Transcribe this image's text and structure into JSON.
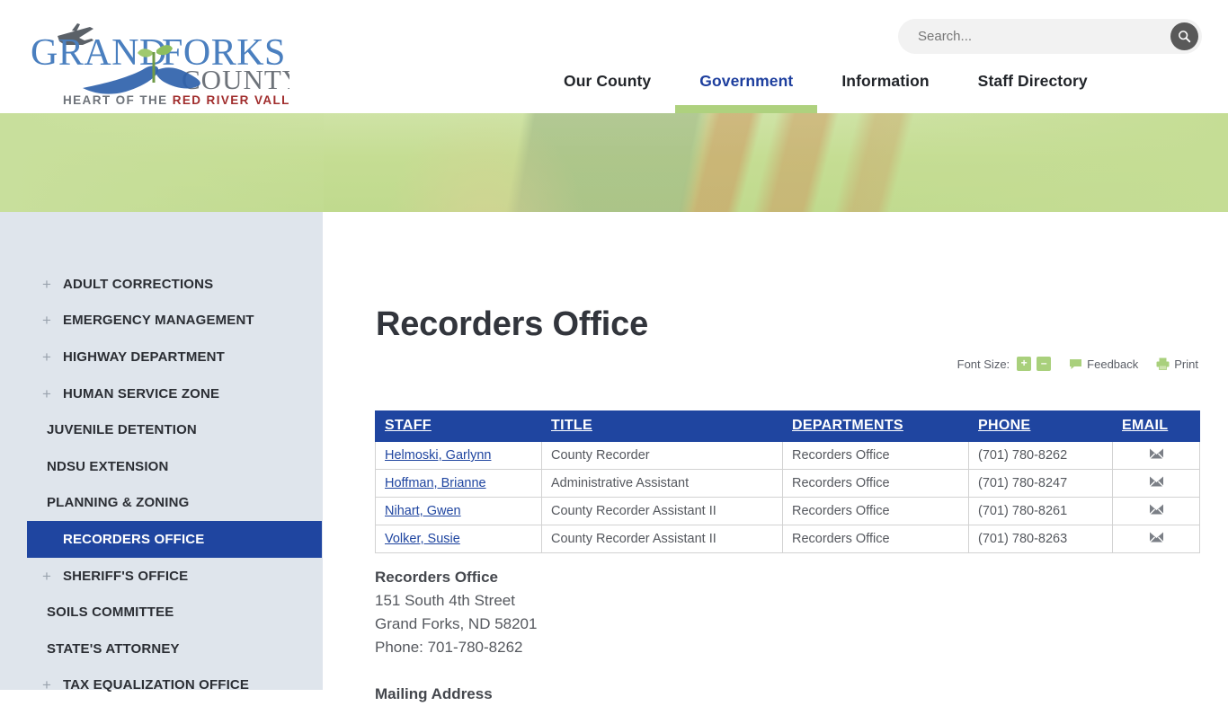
{
  "site": {
    "logo": {
      "line1": "GRAND",
      "line2": "FORKS",
      "line3": "COUNTY",
      "tagline_plain_1": "HEART OF THE ",
      "tagline_accent": "RED RIVER VALLEY"
    },
    "colors": {
      "brand_blue": "#1f45a0",
      "logo_blue": "#4a7fbf",
      "accent_green": "#a9d07c",
      "banner_green": "#c3dd96",
      "sidebar_bg": "#dfe5ec",
      "logo_red": "#a02c2c"
    }
  },
  "search": {
    "placeholder": "Search...",
    "value": "",
    "icon": "search-icon"
  },
  "nav": {
    "items": [
      {
        "label": "Our County",
        "active": false
      },
      {
        "label": "Government",
        "active": true
      },
      {
        "label": "Information",
        "active": false
      },
      {
        "label": "Staff Directory",
        "active": false
      }
    ]
  },
  "sidebar": {
    "items": [
      {
        "label": "ADULT CORRECTIONS",
        "expandable": true,
        "active": false
      },
      {
        "label": "EMERGENCY MANAGEMENT",
        "expandable": true,
        "active": false
      },
      {
        "label": "HIGHWAY DEPARTMENT",
        "expandable": true,
        "active": false
      },
      {
        "label": "HUMAN SERVICE ZONE",
        "expandable": true,
        "active": false
      },
      {
        "label": "JUVENILE DETENTION",
        "expandable": false,
        "active": false
      },
      {
        "label": "NDSU EXTENSION",
        "expandable": false,
        "active": false
      },
      {
        "label": "PLANNING & ZONING",
        "expandable": false,
        "active": false
      },
      {
        "label": "RECORDERS OFFICE",
        "expandable": false,
        "active": true
      },
      {
        "label": "SHERIFF'S OFFICE",
        "expandable": true,
        "active": false
      },
      {
        "label": "SOILS COMMITTEE",
        "expandable": false,
        "active": false
      },
      {
        "label": "STATE'S ATTORNEY",
        "expandable": false,
        "active": false
      },
      {
        "label": "TAX EQUALIZATION OFFICE",
        "expandable": true,
        "active": false
      }
    ],
    "expand_glyph": "+"
  },
  "main": {
    "page_title": "Recorders Office",
    "utility_bar": {
      "font_size_label": "Font Size:",
      "increase_label": "+",
      "decrease_label": "–",
      "feedback_label": "Feedback",
      "print_label": "Print"
    },
    "staff_table": {
      "columns": [
        "STAFF",
        "TITLE",
        "DEPARTMENTS",
        "PHONE",
        "EMAIL"
      ],
      "rows": [
        {
          "staff": "Helmoski, Garlynn",
          "title": "County Recorder",
          "department": "Recorders Office",
          "phone": "(701) 780-8262",
          "email_icon": "envelope-icon"
        },
        {
          "staff": "Hoffman, Brianne",
          "title": "Administrative Assistant",
          "department": "Recorders Office",
          "phone": "(701) 780-8247",
          "email_icon": "envelope-icon"
        },
        {
          "staff": "Nihart, Gwen",
          "title": "County Recorder Assistant II",
          "department": "Recorders Office",
          "phone": "(701) 780-8261",
          "email_icon": "envelope-icon"
        },
        {
          "staff": "Volker, Susie",
          "title": "County Recorder Assistant II",
          "department": "Recorders Office",
          "phone": "(701) 780-8263",
          "email_icon": "envelope-icon"
        }
      ]
    },
    "address": {
      "name": "Recorders Office",
      "street": "151 South 4th Street",
      "city_state_zip": "Grand Forks, ND 58201",
      "phone": "Phone: 701-780-8262",
      "mailing_heading": "Mailing Address"
    }
  }
}
